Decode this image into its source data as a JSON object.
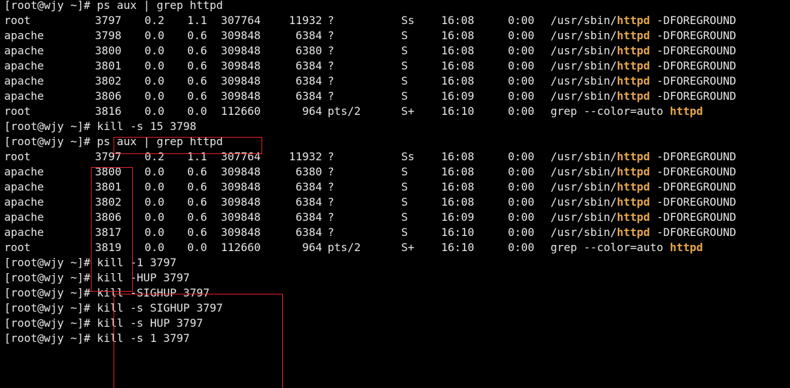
{
  "highlight_term": "httpd",
  "colors": {
    "background": "#000000",
    "text": "#e6e6e6",
    "match_highlight": "#e6a64c",
    "annotation_box": "#e8232a"
  },
  "lines": [
    {
      "type": "prompt",
      "prompt": "[root@wjy ~]#",
      "command": "ps aux | grep httpd"
    },
    {
      "type": "proc",
      "user": "root",
      "pid": "3797",
      "cpu": "0.2",
      "mem": "1.1",
      "vsz": "307764",
      "rss": "11932",
      "tty": "?",
      "stat": "Ss",
      "start": "16:08",
      "time": "0:00",
      "cmd_pre": "/usr/sbin/",
      "cmd_hl": "httpd",
      "cmd_post": " -DFOREGROUND"
    },
    {
      "type": "proc",
      "user": "apache",
      "pid": "3798",
      "cpu": "0.0",
      "mem": "0.6",
      "vsz": "309848",
      "rss": "6384",
      "tty": "?",
      "stat": "S",
      "start": "16:08",
      "time": "0:00",
      "cmd_pre": "/usr/sbin/",
      "cmd_hl": "httpd",
      "cmd_post": " -DFOREGROUND"
    },
    {
      "type": "proc",
      "user": "apache",
      "pid": "3800",
      "cpu": "0.0",
      "mem": "0.6",
      "vsz": "309848",
      "rss": "6380",
      "tty": "?",
      "stat": "S",
      "start": "16:08",
      "time": "0:00",
      "cmd_pre": "/usr/sbin/",
      "cmd_hl": "httpd",
      "cmd_post": " -DFOREGROUND"
    },
    {
      "type": "proc",
      "user": "apache",
      "pid": "3801",
      "cpu": "0.0",
      "mem": "0.6",
      "vsz": "309848",
      "rss": "6384",
      "tty": "?",
      "stat": "S",
      "start": "16:08",
      "time": "0:00",
      "cmd_pre": "/usr/sbin/",
      "cmd_hl": "httpd",
      "cmd_post": " -DFOREGROUND"
    },
    {
      "type": "proc",
      "user": "apache",
      "pid": "3802",
      "cpu": "0.0",
      "mem": "0.6",
      "vsz": "309848",
      "rss": "6384",
      "tty": "?",
      "stat": "S",
      "start": "16:08",
      "time": "0:00",
      "cmd_pre": "/usr/sbin/",
      "cmd_hl": "httpd",
      "cmd_post": " -DFOREGROUND"
    },
    {
      "type": "proc",
      "user": "apache",
      "pid": "3806",
      "cpu": "0.0",
      "mem": "0.6",
      "vsz": "309848",
      "rss": "6384",
      "tty": "?",
      "stat": "S",
      "start": "16:09",
      "time": "0:00",
      "cmd_pre": "/usr/sbin/",
      "cmd_hl": "httpd",
      "cmd_post": " -DFOREGROUND"
    },
    {
      "type": "proc",
      "user": "root",
      "pid": "3816",
      "cpu": "0.0",
      "mem": "0.0",
      "vsz": "112660",
      "rss": "964",
      "tty": "pts/2",
      "stat": "S+",
      "start": "16:10",
      "time": "0:00",
      "cmd_pre": "grep --color=auto ",
      "cmd_hl": "httpd",
      "cmd_post": ""
    },
    {
      "type": "prompt",
      "prompt": "[root@wjy ~]#",
      "command": "kill -s 15 3798"
    },
    {
      "type": "prompt",
      "prompt": "[root@wjy ~]#",
      "command": "ps aux | grep httpd"
    },
    {
      "type": "proc",
      "user": "root",
      "pid": "3797",
      "cpu": "0.2",
      "mem": "1.1",
      "vsz": "307764",
      "rss": "11932",
      "tty": "?",
      "stat": "Ss",
      "start": "16:08",
      "time": "0:00",
      "cmd_pre": "/usr/sbin/",
      "cmd_hl": "httpd",
      "cmd_post": " -DFOREGROUND"
    },
    {
      "type": "proc",
      "user": "apache",
      "pid": "3800",
      "cpu": "0.0",
      "mem": "0.6",
      "vsz": "309848",
      "rss": "6380",
      "tty": "?",
      "stat": "S",
      "start": "16:08",
      "time": "0:00",
      "cmd_pre": "/usr/sbin/",
      "cmd_hl": "httpd",
      "cmd_post": " -DFOREGROUND"
    },
    {
      "type": "proc",
      "user": "apache",
      "pid": "3801",
      "cpu": "0.0",
      "mem": "0.6",
      "vsz": "309848",
      "rss": "6384",
      "tty": "?",
      "stat": "S",
      "start": "16:08",
      "time": "0:00",
      "cmd_pre": "/usr/sbin/",
      "cmd_hl": "httpd",
      "cmd_post": " -DFOREGROUND"
    },
    {
      "type": "proc",
      "user": "apache",
      "pid": "3802",
      "cpu": "0.0",
      "mem": "0.6",
      "vsz": "309848",
      "rss": "6384",
      "tty": "?",
      "stat": "S",
      "start": "16:08",
      "time": "0:00",
      "cmd_pre": "/usr/sbin/",
      "cmd_hl": "httpd",
      "cmd_post": " -DFOREGROUND"
    },
    {
      "type": "proc",
      "user": "apache",
      "pid": "3806",
      "cpu": "0.0",
      "mem": "0.6",
      "vsz": "309848",
      "rss": "6384",
      "tty": "?",
      "stat": "S",
      "start": "16:09",
      "time": "0:00",
      "cmd_pre": "/usr/sbin/",
      "cmd_hl": "httpd",
      "cmd_post": " -DFOREGROUND"
    },
    {
      "type": "proc",
      "user": "apache",
      "pid": "3817",
      "cpu": "0.0",
      "mem": "0.6",
      "vsz": "309848",
      "rss": "6384",
      "tty": "?",
      "stat": "S",
      "start": "16:10",
      "time": "0:00",
      "cmd_pre": "/usr/sbin/",
      "cmd_hl": "httpd",
      "cmd_post": " -DFOREGROUND"
    },
    {
      "type": "proc",
      "user": "root",
      "pid": "3819",
      "cpu": "0.0",
      "mem": "0.0",
      "vsz": "112660",
      "rss": "964",
      "tty": "pts/2",
      "stat": "S+",
      "start": "16:10",
      "time": "0:00",
      "cmd_pre": "grep --color=auto ",
      "cmd_hl": "httpd",
      "cmd_post": ""
    },
    {
      "type": "prompt",
      "prompt": "[root@wjy ~]#",
      "command": "kill -1 3797"
    },
    {
      "type": "prompt",
      "prompt": "[root@wjy ~]#",
      "command": "kill -HUP 3797"
    },
    {
      "type": "prompt",
      "prompt": "[root@wjy ~]#",
      "command": "kill -SIGHUP 3797"
    },
    {
      "type": "prompt",
      "prompt": "[root@wjy ~]#",
      "command": "kill -s SIGHUP 3797"
    },
    {
      "type": "prompt",
      "prompt": "[root@wjy ~]#",
      "command": "kill -s HUP 3797"
    },
    {
      "type": "prompt",
      "prompt": "[root@wjy ~]#",
      "command": "kill -s 1 3797"
    }
  ]
}
